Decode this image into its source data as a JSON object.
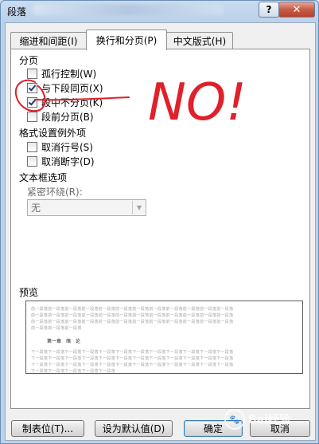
{
  "window": {
    "title": "段落",
    "help_label": "?",
    "close_label": "✕"
  },
  "tabs": [
    {
      "label": "缩进和间距(I)",
      "active": false
    },
    {
      "label": "换行和分页(P)",
      "active": true
    },
    {
      "label": "中文版式(H)",
      "active": false
    }
  ],
  "pagination": {
    "heading": "分页",
    "options": [
      {
        "label": "孤行控制(W)",
        "checked": false
      },
      {
        "label": "与下段同页(X)",
        "checked": true
      },
      {
        "label": "段中不分页(K)",
        "checked": true
      },
      {
        "label": "段前分页(B)",
        "checked": false
      }
    ]
  },
  "exceptions": {
    "heading": "格式设置例外项",
    "options": [
      {
        "label": "取消行号(S)",
        "checked": false
      },
      {
        "label": "取消断字(D)",
        "checked": false
      }
    ]
  },
  "textbox": {
    "heading": "文本框选项",
    "wrap_label": "紧密环绕(R):",
    "wrap_value": "无"
  },
  "preview": {
    "heading": "预览",
    "prev_line": "前一段落前一段落前一段落前一段落前一段落前一段落前一段落前一段落前一段落前一段落前一段落前一段落",
    "prev_line_short": "前一段落前一段落前一段落",
    "sample": [
      "第一章",
      "绪",
      "论"
    ],
    "next_line": "下一段落下一段落下一段落下一段落下一段落下一段落下一段落下一段落下一段落下一段落下一段落下一段落",
    "next_line_short": "下一段落下一段落下一段落下一段落下一段落"
  },
  "buttons": {
    "tabs": "制表位(T)...",
    "set_default": "设为默认值(D)",
    "ok": "确定",
    "cancel": "取消"
  },
  "annotation": {
    "text": "NO!",
    "color": "#e0202a"
  },
  "watermark": {
    "text": "Bai经验"
  }
}
